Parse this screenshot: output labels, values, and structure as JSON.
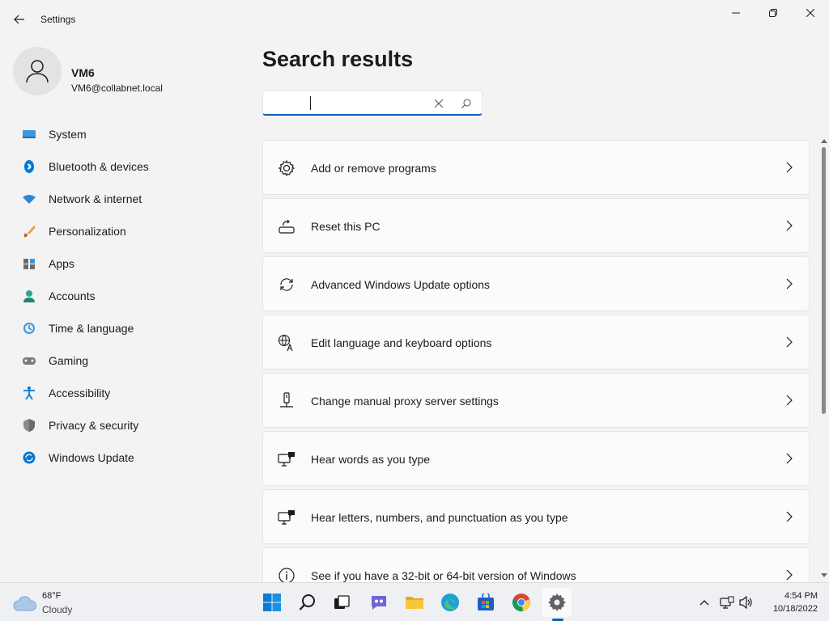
{
  "window": {
    "title": "Settings"
  },
  "profile": {
    "name": "VM6",
    "email": "VM6@collabnet.local"
  },
  "nav": {
    "items": [
      {
        "label": "System",
        "icon": "system-icon"
      },
      {
        "label": "Bluetooth & devices",
        "icon": "bluetooth-icon"
      },
      {
        "label": "Network & internet",
        "icon": "wifi-icon"
      },
      {
        "label": "Personalization",
        "icon": "brush-icon"
      },
      {
        "label": "Apps",
        "icon": "apps-icon"
      },
      {
        "label": "Accounts",
        "icon": "accounts-icon"
      },
      {
        "label": "Time & language",
        "icon": "time-language-icon"
      },
      {
        "label": "Gaming",
        "icon": "gamepad-icon"
      },
      {
        "label": "Accessibility",
        "icon": "accessibility-icon"
      },
      {
        "label": "Privacy & security",
        "icon": "shield-icon"
      },
      {
        "label": "Windows Update",
        "icon": "update-icon"
      }
    ]
  },
  "main": {
    "title": "Search results",
    "search": {
      "value": "",
      "placeholder": ""
    },
    "results": [
      {
        "label": "Add or remove programs",
        "icon": "gear-icon"
      },
      {
        "label": "Reset this PC",
        "icon": "reset-pc-icon"
      },
      {
        "label": "Advanced Windows Update options",
        "icon": "sync-icon"
      },
      {
        "label": "Edit language and keyboard options",
        "icon": "language-icon"
      },
      {
        "label": "Change manual proxy server settings",
        "icon": "proxy-icon"
      },
      {
        "label": "Hear words as you type",
        "icon": "narrator-icon"
      },
      {
        "label": "Hear letters, numbers, and punctuation as you type",
        "icon": "narrator-icon"
      },
      {
        "label": "See if you have a 32-bit or 64-bit version of Windows",
        "icon": "info-icon"
      }
    ]
  },
  "taskbar": {
    "weather": {
      "temp": "68°F",
      "desc": "Cloudy"
    },
    "apps": [
      "start",
      "search",
      "task-view",
      "chat",
      "file-explorer",
      "edge",
      "store",
      "chrome",
      "settings"
    ],
    "clock": {
      "time": "4:54 PM",
      "date": "10/18/2022"
    }
  },
  "colors": {
    "accent": "#005fb8",
    "background": "#f3f3f3",
    "card": "#fbfbfb"
  }
}
